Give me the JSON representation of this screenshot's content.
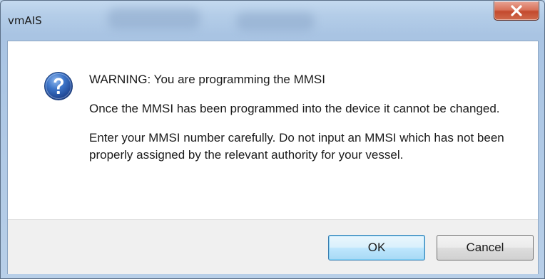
{
  "window": {
    "title": "vmAIS",
    "close_icon": "close-icon"
  },
  "dialog": {
    "icon": "question-icon",
    "heading": "WARNING: You are programming the MMSI",
    "paragraph_1": "Once the MMSI has been programmed into the device it cannot be changed.",
    "paragraph_2": "Enter your MMSI number carefully. Do not input an MMSI which has not been properly assigned by the relevant authority for your vessel."
  },
  "buttons": {
    "ok_label": "OK",
    "cancel_label": "Cancel"
  },
  "colors": {
    "close_button": "#c44a2e",
    "question_icon": "#2a5fb0",
    "footer_bg": "#f0f0f0"
  }
}
